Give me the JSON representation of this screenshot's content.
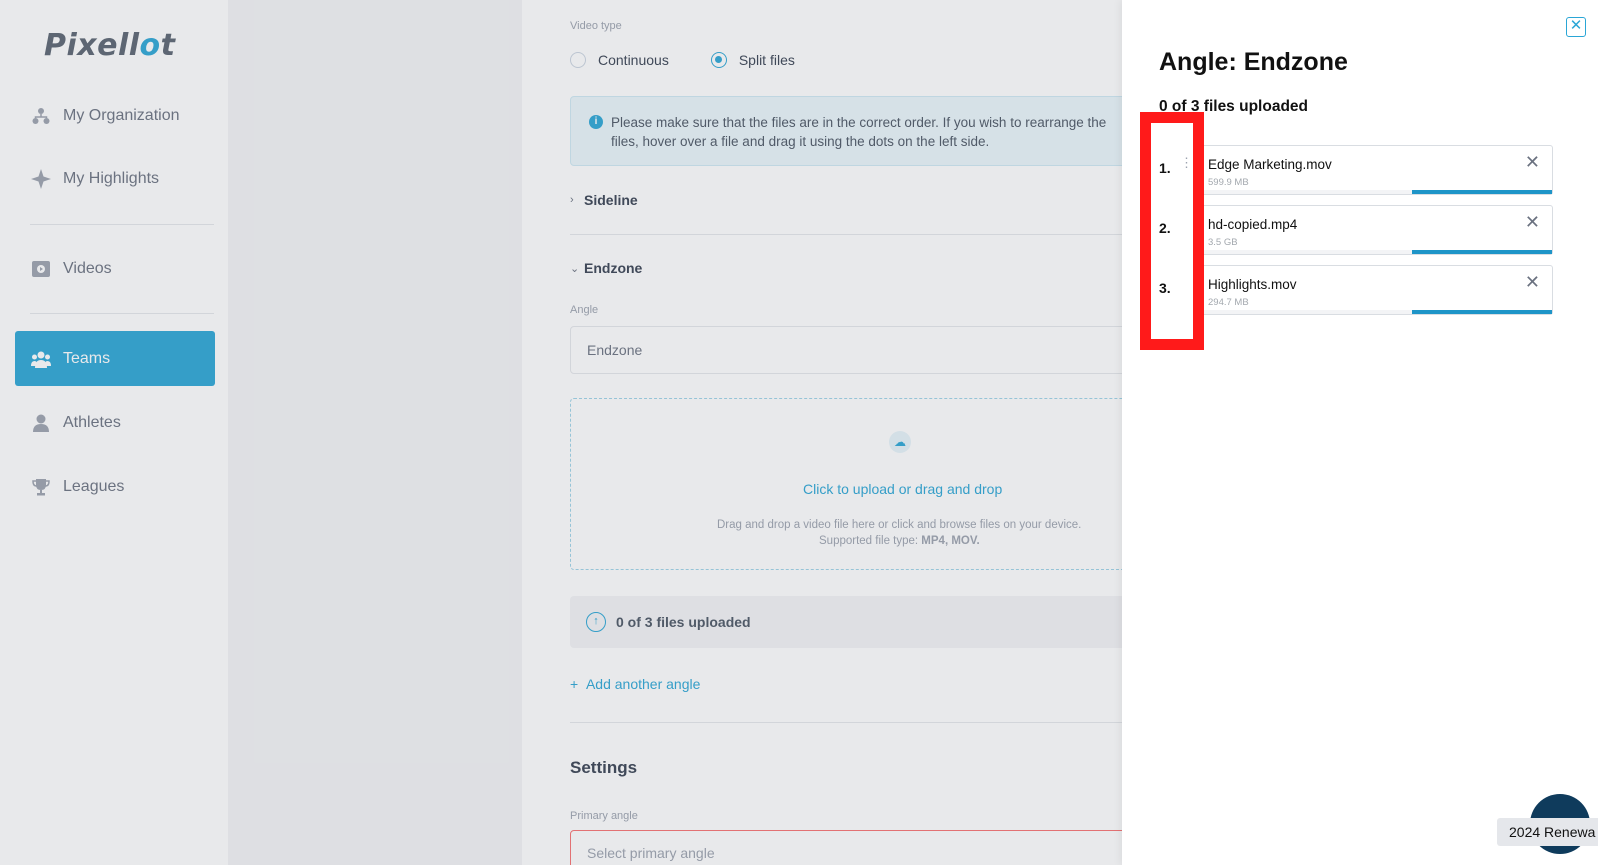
{
  "sidebar": {
    "logo": {
      "part1": "Pixell",
      "part2": "o",
      "part3": "t"
    },
    "items": [
      {
        "label": "My Organization",
        "icon": "organization-icon"
      },
      {
        "label": "My Highlights",
        "icon": "sparkle-icon"
      },
      {
        "label": "Videos",
        "icon": "video-icon"
      },
      {
        "label": "Teams",
        "icon": "teams-icon",
        "active": true
      },
      {
        "label": "Athletes",
        "icon": "athlete-icon"
      },
      {
        "label": "Leagues",
        "icon": "trophy-icon"
      }
    ]
  },
  "main": {
    "video_type_label": "Video type",
    "radio_continuous": "Continuous",
    "radio_split": "Split files",
    "info_text": "Please make sure that the files are in the correct order. If you wish to rearrange the files, hover over a file and drag it using the dots on the left side.",
    "section_sideline": "Sideline",
    "section_endzone": "Endzone",
    "angle_label": "Angle",
    "angle_value": "Endzone",
    "dropzone_cta": "Click to upload or drag and drop",
    "dropzone_hint1": "Drag and drop a video file here or click and browse files on your device.",
    "dropzone_hint2_prefix": "Supported file type: ",
    "dropzone_hint2_types": "MP4, MOV.",
    "upload_status": "0 of 3 files uploaded",
    "add_angle": "Add another angle",
    "settings_title": "Settings",
    "primary_angle_label": "Primary angle",
    "primary_angle_placeholder": "Select primary angle"
  },
  "drawer": {
    "title": "Angle: Endzone",
    "subtitle": "0 of 3 files uploaded",
    "files": [
      {
        "num": "1.",
        "name": "Edge Marketing.mov",
        "size": "599.9 MB",
        "progress": 0.4
      },
      {
        "num": "2.",
        "name": "hd-copied.mp4",
        "size": "3.5 GB",
        "progress": 0.4
      },
      {
        "num": "3.",
        "name": "Highlights.mov",
        "size": "294.7 MB",
        "progress": 0.4
      }
    ]
  },
  "footer": {
    "renewal_badge": "2024 Renewa"
  },
  "colors": {
    "accent": "#2aa6d6",
    "highlight": "#ff1a1a",
    "progress": "#1e95c8"
  }
}
